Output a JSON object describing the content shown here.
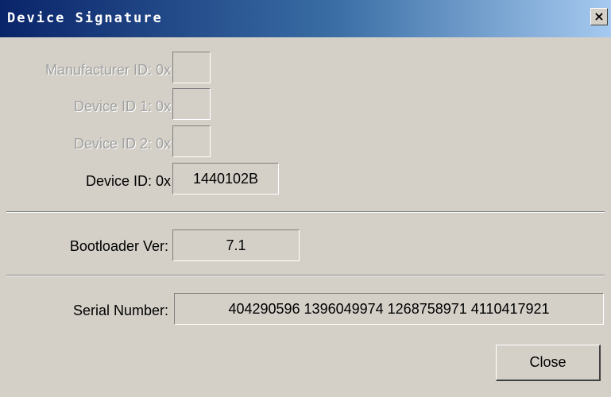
{
  "window": {
    "title": "Device Signature",
    "close_glyph": "×"
  },
  "fields": {
    "manufacturer_id": {
      "label": "Manufacturer ID: 0x",
      "value": ""
    },
    "device_id_1": {
      "label": "Device ID 1: 0x",
      "value": ""
    },
    "device_id_2": {
      "label": "Device ID 2: 0x",
      "value": ""
    },
    "device_id": {
      "label": "Device ID: 0x",
      "value": "1440102B"
    },
    "bootloader_ver": {
      "label": "Bootloader Ver:",
      "value": "7.1"
    },
    "serial_number": {
      "label": "Serial Number:",
      "value": "404290596 1396049974 1268758971 4110417921"
    }
  },
  "buttons": {
    "close_label": "Close"
  }
}
